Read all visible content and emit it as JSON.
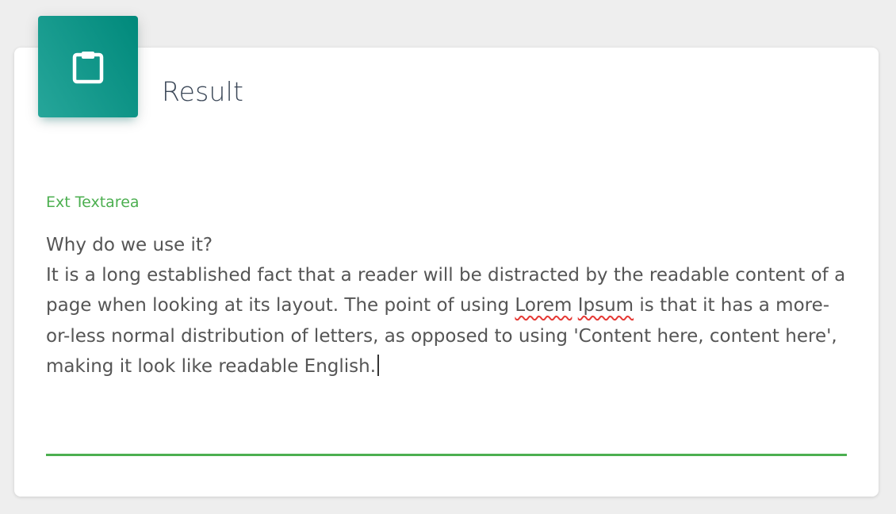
{
  "card": {
    "title": "Result",
    "icon": "clipboard-icon",
    "icon_gradient": [
      "#26a69a",
      "#00897b"
    ]
  },
  "field": {
    "label": "Ext Textarea",
    "accent_color": "#4caf50",
    "value_parts": [
      "Why do we use it?\nIt is a long established fact that a reader will be distracted by the readable content of a page when looking at its layout. The point of using ",
      "Lorem",
      " ",
      "Ipsum",
      " is that it has a more-or-less normal distribution of letters, as opposed to using 'Content here, content here', making it look like readable English."
    ],
    "spellcheck_flagged": [
      "Lorem",
      "Ipsum"
    ]
  }
}
